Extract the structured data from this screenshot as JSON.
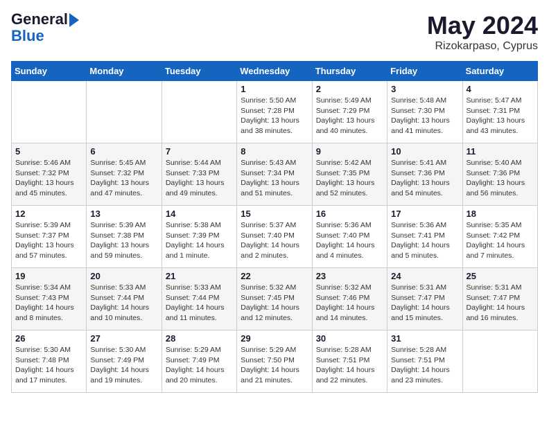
{
  "header": {
    "logo_line1": "General",
    "logo_line2": "Blue",
    "month_title": "May 2024",
    "location": "Rizokarpaso, Cyprus"
  },
  "weekdays": [
    "Sunday",
    "Monday",
    "Tuesday",
    "Wednesday",
    "Thursday",
    "Friday",
    "Saturday"
  ],
  "weeks": [
    [
      {
        "day": "",
        "info": ""
      },
      {
        "day": "",
        "info": ""
      },
      {
        "day": "",
        "info": ""
      },
      {
        "day": "1",
        "info": "Sunrise: 5:50 AM\nSunset: 7:28 PM\nDaylight: 13 hours\nand 38 minutes."
      },
      {
        "day": "2",
        "info": "Sunrise: 5:49 AM\nSunset: 7:29 PM\nDaylight: 13 hours\nand 40 minutes."
      },
      {
        "day": "3",
        "info": "Sunrise: 5:48 AM\nSunset: 7:30 PM\nDaylight: 13 hours\nand 41 minutes."
      },
      {
        "day": "4",
        "info": "Sunrise: 5:47 AM\nSunset: 7:31 PM\nDaylight: 13 hours\nand 43 minutes."
      }
    ],
    [
      {
        "day": "5",
        "info": "Sunrise: 5:46 AM\nSunset: 7:32 PM\nDaylight: 13 hours\nand 45 minutes."
      },
      {
        "day": "6",
        "info": "Sunrise: 5:45 AM\nSunset: 7:32 PM\nDaylight: 13 hours\nand 47 minutes."
      },
      {
        "day": "7",
        "info": "Sunrise: 5:44 AM\nSunset: 7:33 PM\nDaylight: 13 hours\nand 49 minutes."
      },
      {
        "day": "8",
        "info": "Sunrise: 5:43 AM\nSunset: 7:34 PM\nDaylight: 13 hours\nand 51 minutes."
      },
      {
        "day": "9",
        "info": "Sunrise: 5:42 AM\nSunset: 7:35 PM\nDaylight: 13 hours\nand 52 minutes."
      },
      {
        "day": "10",
        "info": "Sunrise: 5:41 AM\nSunset: 7:36 PM\nDaylight: 13 hours\nand 54 minutes."
      },
      {
        "day": "11",
        "info": "Sunrise: 5:40 AM\nSunset: 7:36 PM\nDaylight: 13 hours\nand 56 minutes."
      }
    ],
    [
      {
        "day": "12",
        "info": "Sunrise: 5:39 AM\nSunset: 7:37 PM\nDaylight: 13 hours\nand 57 minutes."
      },
      {
        "day": "13",
        "info": "Sunrise: 5:39 AM\nSunset: 7:38 PM\nDaylight: 13 hours\nand 59 minutes."
      },
      {
        "day": "14",
        "info": "Sunrise: 5:38 AM\nSunset: 7:39 PM\nDaylight: 14 hours\nand 1 minute."
      },
      {
        "day": "15",
        "info": "Sunrise: 5:37 AM\nSunset: 7:40 PM\nDaylight: 14 hours\nand 2 minutes."
      },
      {
        "day": "16",
        "info": "Sunrise: 5:36 AM\nSunset: 7:40 PM\nDaylight: 14 hours\nand 4 minutes."
      },
      {
        "day": "17",
        "info": "Sunrise: 5:36 AM\nSunset: 7:41 PM\nDaylight: 14 hours\nand 5 minutes."
      },
      {
        "day": "18",
        "info": "Sunrise: 5:35 AM\nSunset: 7:42 PM\nDaylight: 14 hours\nand 7 minutes."
      }
    ],
    [
      {
        "day": "19",
        "info": "Sunrise: 5:34 AM\nSunset: 7:43 PM\nDaylight: 14 hours\nand 8 minutes."
      },
      {
        "day": "20",
        "info": "Sunrise: 5:33 AM\nSunset: 7:44 PM\nDaylight: 14 hours\nand 10 minutes."
      },
      {
        "day": "21",
        "info": "Sunrise: 5:33 AM\nSunset: 7:44 PM\nDaylight: 14 hours\nand 11 minutes."
      },
      {
        "day": "22",
        "info": "Sunrise: 5:32 AM\nSunset: 7:45 PM\nDaylight: 14 hours\nand 12 minutes."
      },
      {
        "day": "23",
        "info": "Sunrise: 5:32 AM\nSunset: 7:46 PM\nDaylight: 14 hours\nand 14 minutes."
      },
      {
        "day": "24",
        "info": "Sunrise: 5:31 AM\nSunset: 7:47 PM\nDaylight: 14 hours\nand 15 minutes."
      },
      {
        "day": "25",
        "info": "Sunrise: 5:31 AM\nSunset: 7:47 PM\nDaylight: 14 hours\nand 16 minutes."
      }
    ],
    [
      {
        "day": "26",
        "info": "Sunrise: 5:30 AM\nSunset: 7:48 PM\nDaylight: 14 hours\nand 17 minutes."
      },
      {
        "day": "27",
        "info": "Sunrise: 5:30 AM\nSunset: 7:49 PM\nDaylight: 14 hours\nand 19 minutes."
      },
      {
        "day": "28",
        "info": "Sunrise: 5:29 AM\nSunset: 7:49 PM\nDaylight: 14 hours\nand 20 minutes."
      },
      {
        "day": "29",
        "info": "Sunrise: 5:29 AM\nSunset: 7:50 PM\nDaylight: 14 hours\nand 21 minutes."
      },
      {
        "day": "30",
        "info": "Sunrise: 5:28 AM\nSunset: 7:51 PM\nDaylight: 14 hours\nand 22 minutes."
      },
      {
        "day": "31",
        "info": "Sunrise: 5:28 AM\nSunset: 7:51 PM\nDaylight: 14 hours\nand 23 minutes."
      },
      {
        "day": "",
        "info": ""
      }
    ]
  ]
}
